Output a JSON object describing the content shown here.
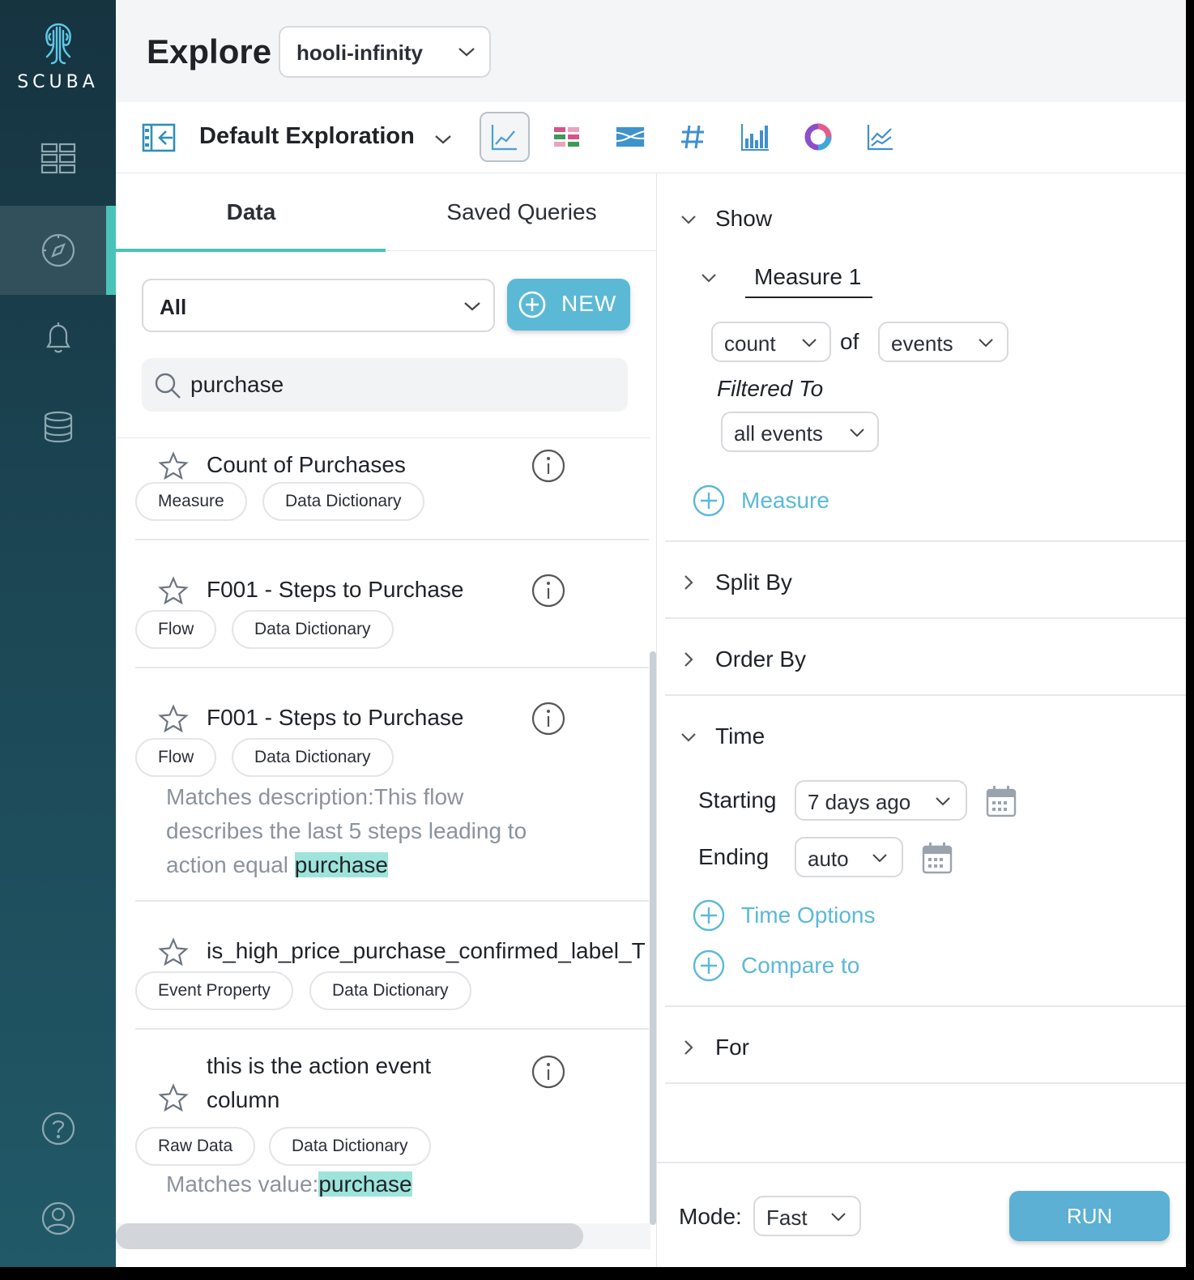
{
  "brand": {
    "name": "SCUBA",
    "accent": "#49c3b8",
    "primary": "#5bb9d6"
  },
  "sidebar": {
    "items": [
      {
        "icon": "boards-grid-icon"
      },
      {
        "icon": "compass-icon",
        "active": true
      },
      {
        "icon": "bell-icon"
      },
      {
        "icon": "database-icon"
      },
      {
        "icon": "help-icon"
      },
      {
        "icon": "user-icon"
      }
    ]
  },
  "header": {
    "title": "Explore",
    "org": "hooli-infinity"
  },
  "toolbar": {
    "exploration_name": "Default Exploration",
    "viz_types": [
      "line-chart-icon",
      "heatmap-icon",
      "sankey-icon",
      "number-icon",
      "bar-chart-icon",
      "donut-icon",
      "compare-line-icon"
    ],
    "selected_viz": "line-chart-icon"
  },
  "left_panel": {
    "tabs": [
      {
        "label": "Data",
        "active": true
      },
      {
        "label": "Saved Queries",
        "active": false
      }
    ],
    "filter": {
      "value": "All"
    },
    "new_button": "NEW",
    "search": {
      "value": "purchase"
    },
    "results": [
      {
        "title": "Count of Purchases",
        "tags": [
          "Measure",
          "Data Dictionary"
        ]
      },
      {
        "title": "F001 - Steps to Purchase",
        "tags": [
          "Flow",
          "Data Dictionary"
        ]
      },
      {
        "title": "F001 - Steps to Purchase",
        "tags": [
          "Flow",
          "Data Dictionary"
        ],
        "match_line1": "Matches description:This flow",
        "match_line2": "describes the last 5 steps leading to",
        "match_prefix": "action equal ",
        "match_highlight": "purchase"
      },
      {
        "title": "is_high_price_purchase_confirmed_label_T",
        "tags": [
          "Event Property",
          "Data Dictionary"
        ]
      },
      {
        "title_line1": "this is the action event",
        "title_line2": "column",
        "tags": [
          "Raw Data",
          "Data Dictionary"
        ],
        "match_prefix": "Matches value:",
        "match_highlight": "purchase"
      }
    ]
  },
  "right_panel": {
    "show": {
      "label": "Show",
      "measure_tab": "Measure 1",
      "aggregate": "count",
      "of_label": "of",
      "target": "events",
      "filtered_label": "Filtered To",
      "filter_value": "all events",
      "add_measure": "Measure"
    },
    "split_by": "Split By",
    "order_by": "Order By",
    "time": {
      "label": "Time",
      "starting_label": "Starting",
      "starting_value": "7 days ago",
      "ending_label": "Ending",
      "ending_value": "auto",
      "time_options": "Time Options",
      "compare_to": "Compare to"
    },
    "for": "For",
    "footer": {
      "mode_label": "Mode:",
      "mode_value": "Fast",
      "run": "RUN"
    }
  }
}
